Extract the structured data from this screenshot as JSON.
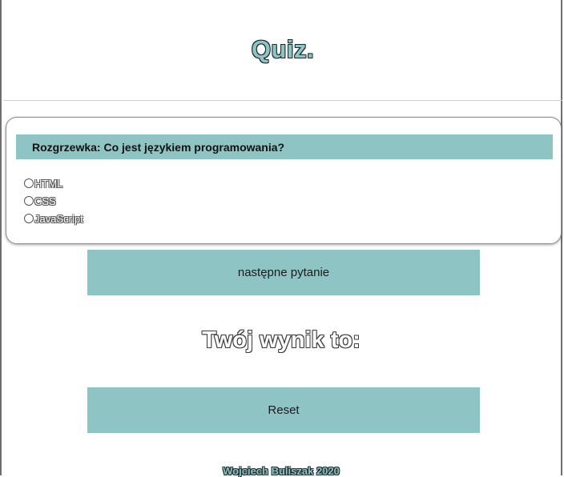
{
  "header": {
    "title": "Quiz."
  },
  "quiz": {
    "question": "Rozgrzewka: Co jest językiem programowania?",
    "answers": [
      {
        "label": "HTML"
      },
      {
        "label": "CSS"
      },
      {
        "label": "JavaScript"
      }
    ]
  },
  "buttons": {
    "next_label": "następne pytanie",
    "reset_label": "Reset"
  },
  "score": {
    "text": "Twój wynik to:"
  },
  "footer": {
    "text": "Wojciech Buliszak 2020"
  },
  "colors": {
    "accent": "#8fc4c5",
    "card_border": "#8d8d8d",
    "page_background": "#ffffff"
  }
}
